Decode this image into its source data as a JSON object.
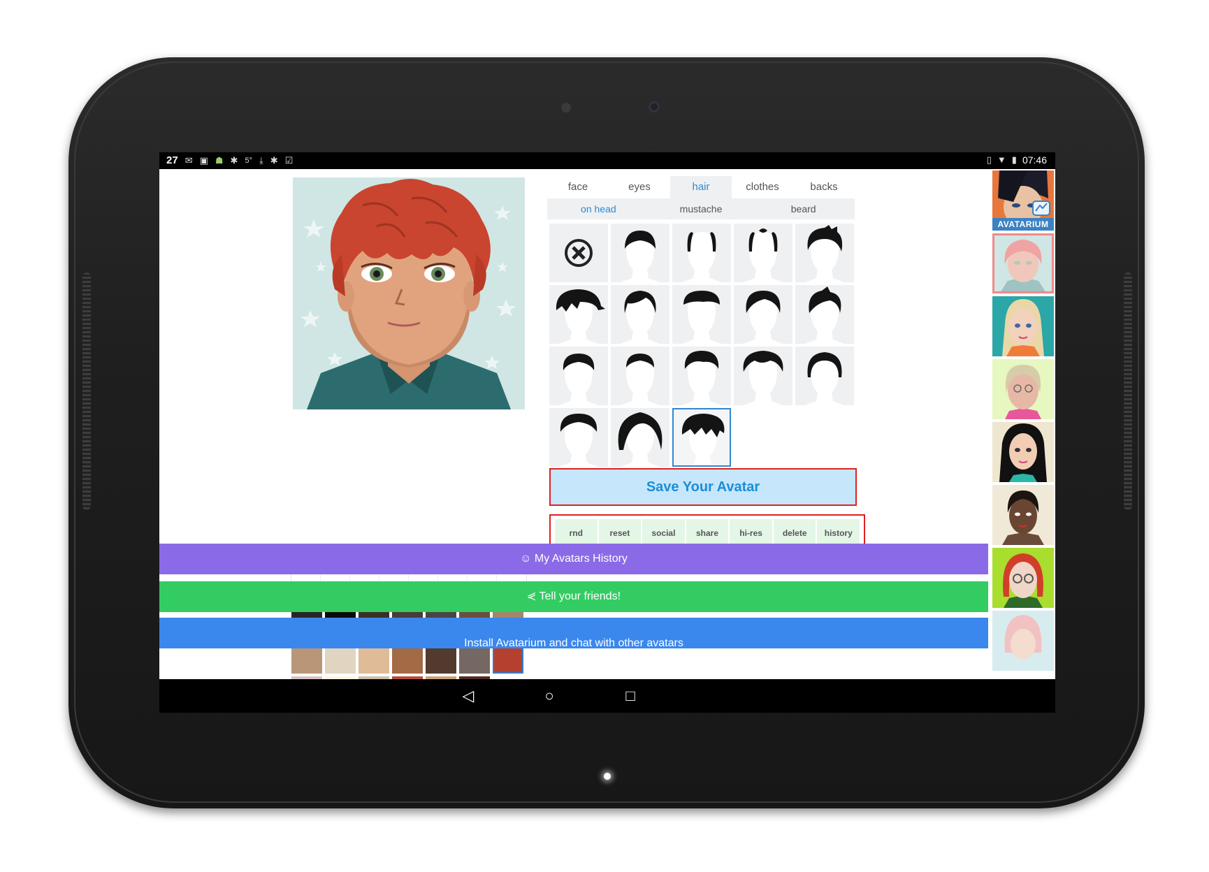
{
  "statusbar": {
    "date_day": "27",
    "notif_icons": [
      "gmail-icon",
      "image-icon",
      "android-icon",
      "bug-icon",
      "temperature-icon",
      "download-icon",
      "clipboard-icon"
    ],
    "temperature": "5°",
    "time": "07:46",
    "right_icons": [
      "vibrate-icon",
      "wifi-icon",
      "battery-icon"
    ]
  },
  "editor": {
    "tabs": [
      {
        "label": "face",
        "active": false
      },
      {
        "label": "eyes",
        "active": false
      },
      {
        "label": "hair",
        "active": true
      },
      {
        "label": "clothes",
        "active": false
      },
      {
        "label": "backs",
        "active": false
      }
    ],
    "subtabs": [
      {
        "label": "on head",
        "active": true
      },
      {
        "label": "mustache",
        "active": false
      },
      {
        "label": "beard",
        "active": false
      }
    ],
    "hair_styles_count": 18,
    "selected_hair_index": 17,
    "tools": [
      "arrow-up-icon",
      "arrow-down-icon",
      "arrow-left-icon",
      "arrow-right-icon",
      "zoom-out-icon",
      "zoom-in-icon",
      "undo-icon",
      "redo-icon"
    ],
    "colors": [
      "#2a2428",
      "#0a0a0a",
      "#3a2f27",
      "#4a3c37",
      "#4b4443",
      "#6a4e3f",
      "#a3866c",
      "#b89677",
      "#e1d4c0",
      "#dfbb98",
      "#a36b45",
      "#533a2f",
      "#756761",
      "#b6402f",
      "#d7c3c2",
      "#fcf5e2",
      "#cabfae",
      "#b54c38",
      "#c9a27a",
      "#4e2c26",
      "#b9402f"
    ],
    "selected_color_index": 13,
    "save_label": "Save Your Avatar",
    "actions": [
      "rnd",
      "reset",
      "social",
      "share",
      "hi-res",
      "delete",
      "history"
    ]
  },
  "bars": {
    "history": "My Avatars History",
    "friends": "Tell your friends!",
    "install": "Install Avatarium and chat with other avatars"
  },
  "sidebar": {
    "logo_text": "AVATARIUM",
    "selected_index": 1
  },
  "colors": {
    "purple_bar": "#8b6ae8",
    "green_bar": "#33cc63",
    "blue_bar": "#3a87ee",
    "accent": "#2d8bd0",
    "save_bg": "#c6e6fb",
    "outline_red": "#e02020"
  }
}
